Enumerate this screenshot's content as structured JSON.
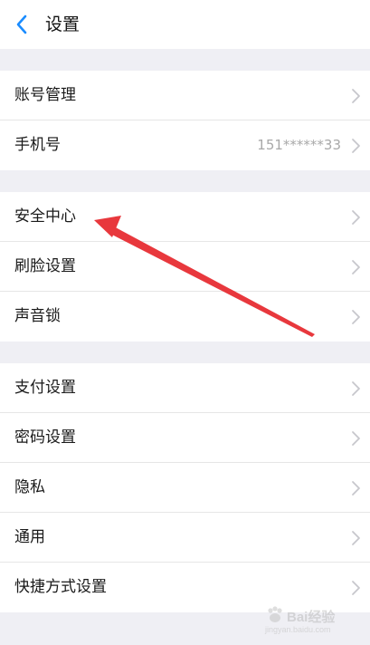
{
  "navbar": {
    "title": "设置",
    "back_icon": "chevron-left-icon"
  },
  "groups": [
    {
      "items": [
        {
          "label": "账号管理",
          "value": ""
        },
        {
          "label": "手机号",
          "value": "151******33"
        }
      ]
    },
    {
      "items": [
        {
          "label": "安全中心",
          "value": ""
        },
        {
          "label": "刷脸设置",
          "value": ""
        },
        {
          "label": "声音锁",
          "value": ""
        }
      ]
    },
    {
      "items": [
        {
          "label": "支付设置",
          "value": ""
        },
        {
          "label": "密码设置",
          "value": ""
        },
        {
          "label": "隐私",
          "value": ""
        },
        {
          "label": "通用",
          "value": ""
        },
        {
          "label": "快捷方式设置",
          "value": ""
        }
      ]
    }
  ],
  "watermark": {
    "brand": "Bai经验",
    "url": "jingyan.baidu.com"
  },
  "colors": {
    "accent": "#1a8cff",
    "annotation": "#e8383d",
    "background": "#efeff4"
  }
}
